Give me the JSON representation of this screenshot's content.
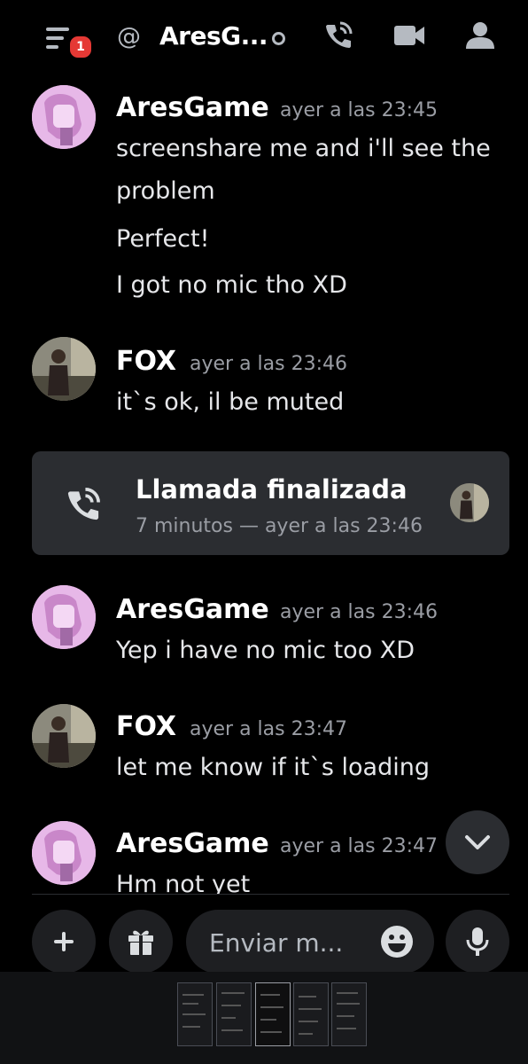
{
  "header": {
    "notification_count": "1",
    "at_symbol": "@",
    "channel_name": "AresG..."
  },
  "messages": [
    {
      "author": "AresGame",
      "timestamp": "ayer a las 23:45",
      "lines": [
        "screenshare me and i'll see the",
        "problem",
        "Perfect!",
        "I got no mic tho XD"
      ]
    },
    {
      "author": "FOX",
      "timestamp": "ayer a las 23:46",
      "lines": [
        "it`s ok, il be muted"
      ]
    },
    {
      "author": "AresGame",
      "timestamp": "ayer a las 23:46",
      "lines": [
        "Yep i have no mic too XD"
      ]
    },
    {
      "author": "FOX",
      "timestamp": "ayer a las 23:47",
      "lines": [
        "let me know if it`s loading"
      ]
    },
    {
      "author": "AresGame",
      "timestamp": "ayer a las 23:47",
      "lines": [
        "Hm not yet"
      ]
    }
  ],
  "call_card": {
    "title": "Llamada finalizada",
    "subtitle": "7 minutos — ayer a las 23:46"
  },
  "composer": {
    "placeholder": "Enviar m..."
  },
  "colors": {
    "background": "#000000",
    "card": "#2b2d31",
    "control": "#1e1f22",
    "badge": "#e53935",
    "muted_text": "#9a9da4"
  },
  "icons": [
    "hamburger-menu-icon",
    "at-icon",
    "status-dot-icon",
    "phone-call-icon",
    "video-camera-icon",
    "members-icon",
    "chevron-down-icon",
    "plus-icon",
    "gift-icon",
    "emoji-icon",
    "microphone-icon"
  ]
}
